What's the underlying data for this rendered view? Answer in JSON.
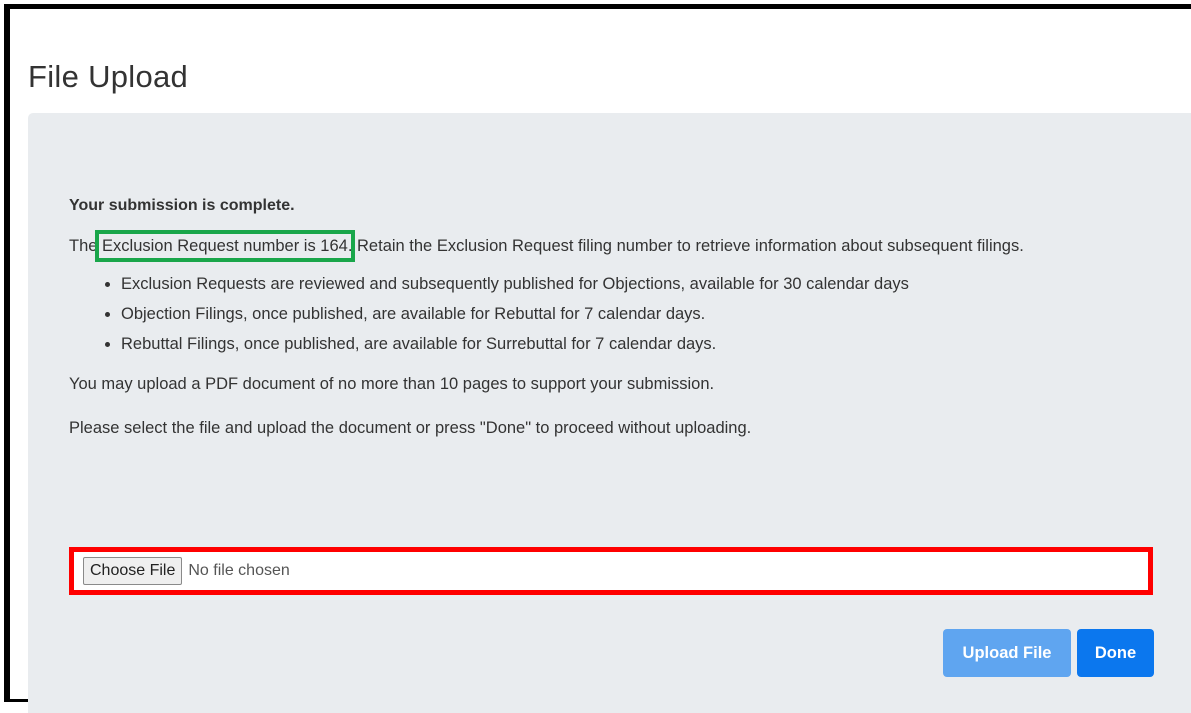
{
  "page": {
    "title": "File Upload"
  },
  "message": {
    "heading": "Your submission is complete.",
    "line_prefix": "The ",
    "request_number_text": "Exclusion Request number is 164",
    "line_suffix": ". Retain the Exclusion Request filing number to retrieve information about subsequent filings."
  },
  "bullets": [
    "Exclusion Requests are reviewed and subsequently published for Objections, available for 30 calendar days",
    "Objection Filings, once published, are available for Rebuttal for 7 calendar days.",
    "Rebuttal Filings, once published, are available for Surrebuttal for 7 calendar days."
  ],
  "upload_info": "You may upload a PDF document of no more than 10 pages to support your submission.",
  "instructions": "Please select the file and upload the document or press \"Done\" to proceed without uploading.",
  "file_input": {
    "button_label": "Choose File",
    "status": "No file chosen"
  },
  "actions": {
    "upload_label": "Upload File",
    "done_label": "Done"
  },
  "colors": {
    "highlight_green": "#19a64a",
    "highlight_red": "#ff0000",
    "primary": "#0b77ee",
    "primary_disabled": "#5fa5f0",
    "panel_bg": "#e9ecef"
  }
}
